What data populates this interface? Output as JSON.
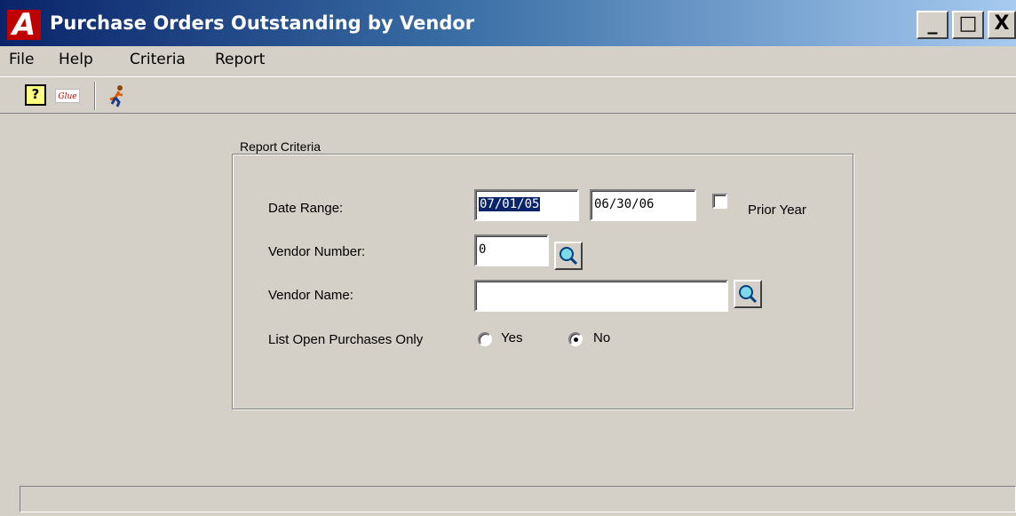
{
  "window": {
    "title": "Purchase Orders Outstanding by Vendor",
    "logo_letter": "A",
    "minimize_glyph": "_",
    "maximize_glyph": "□",
    "close_glyph": "X"
  },
  "menu": [
    "File",
    "Help",
    "Criteria",
    "Report"
  ],
  "toolbar": {
    "help_icon": "help-icon",
    "help_glyph": "?",
    "glue_icon": "glue-icon",
    "glue_text": "Glue",
    "run_icon": "running-man-icon"
  },
  "criteria": {
    "group_title": "Report Criteria",
    "date_range_label": "Date Range:",
    "date_from": "07/01/05",
    "date_to": "06/30/06",
    "prior_year_label": "Prior Year",
    "prior_year_checked": false,
    "vendor_number_label": "Vendor Number:",
    "vendor_number": "0",
    "vendor_name_label": "Vendor Name:",
    "vendor_name": "",
    "open_only_label": "List Open Purchases Only",
    "yes_label": "Yes",
    "no_label": "No",
    "open_only_selected": "No"
  },
  "status": {
    "text": ""
  }
}
